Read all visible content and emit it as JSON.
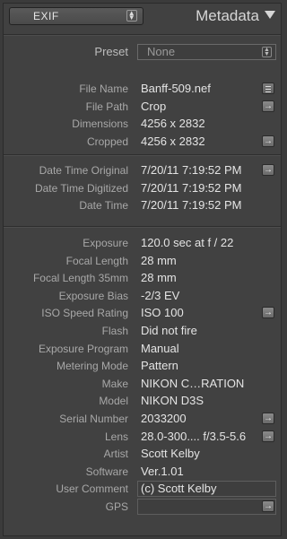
{
  "header": {
    "view_label": "EXIF",
    "title": "Metadata"
  },
  "preset": {
    "label": "Preset",
    "value": "None"
  },
  "groups": [
    {
      "rows": [
        {
          "label": "File Name",
          "value": "Banff-509.nef",
          "control": "list"
        },
        {
          "label": "File Path",
          "value": "Crop",
          "control": "arrow"
        },
        {
          "label": "Dimensions",
          "value": "4256 x 2832",
          "control": ""
        },
        {
          "label": "Cropped",
          "value": "4256 x 2832",
          "control": "arrow"
        }
      ]
    },
    {
      "rows": [
        {
          "label": "Date Time Original",
          "value": "7/20/11 7:19:52 PM",
          "control": "arrow"
        },
        {
          "label": "Date Time Digitized",
          "value": "7/20/11 7:19:52 PM",
          "control": ""
        },
        {
          "label": "Date Time",
          "value": "7/20/11 7:19:52 PM",
          "control": ""
        }
      ]
    },
    {
      "rows": [
        {
          "label": "Exposure",
          "value": "120.0 sec at f / 22",
          "control": ""
        },
        {
          "label": "Focal Length",
          "value": "28 mm",
          "control": ""
        },
        {
          "label": "Focal Length 35mm",
          "value": "28 mm",
          "control": ""
        },
        {
          "label": "Exposure Bias",
          "value": "-2/3 EV",
          "control": ""
        },
        {
          "label": "ISO Speed Rating",
          "value": "ISO 100",
          "control": "arrow"
        },
        {
          "label": "Flash",
          "value": "Did not fire",
          "control": ""
        },
        {
          "label": "Exposure Program",
          "value": "Manual",
          "control": ""
        },
        {
          "label": "Metering Mode",
          "value": "Pattern",
          "control": ""
        },
        {
          "label": "Make",
          "value": "NIKON C…RATION",
          "control": ""
        },
        {
          "label": "Model",
          "value": "NIKON D3S",
          "control": ""
        },
        {
          "label": "Serial Number",
          "value": "2033200",
          "control": "arrow"
        },
        {
          "label": "Lens",
          "value": "28.0-300.... f/3.5-5.6",
          "control": "arrow"
        },
        {
          "label": "Artist",
          "value": "Scott Kelby",
          "control": ""
        },
        {
          "label": "Software",
          "value": "Ver.1.01",
          "control": ""
        },
        {
          "label": "User Comment",
          "value": "(c) Scott Kelby",
          "control": "box"
        },
        {
          "label": "GPS",
          "value": "",
          "control": "box-arrow"
        }
      ]
    }
  ]
}
